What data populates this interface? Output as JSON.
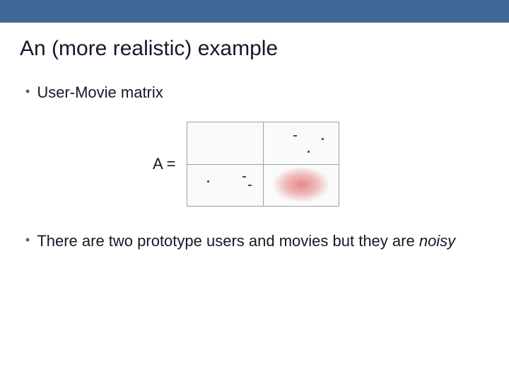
{
  "title": "An (more realistic) example",
  "bullets": {
    "first": "User-Movie matrix",
    "second_pre": "There are two prototype users and movies but they are ",
    "second_noisy": "noisy"
  },
  "matrix": {
    "label": "A ="
  }
}
